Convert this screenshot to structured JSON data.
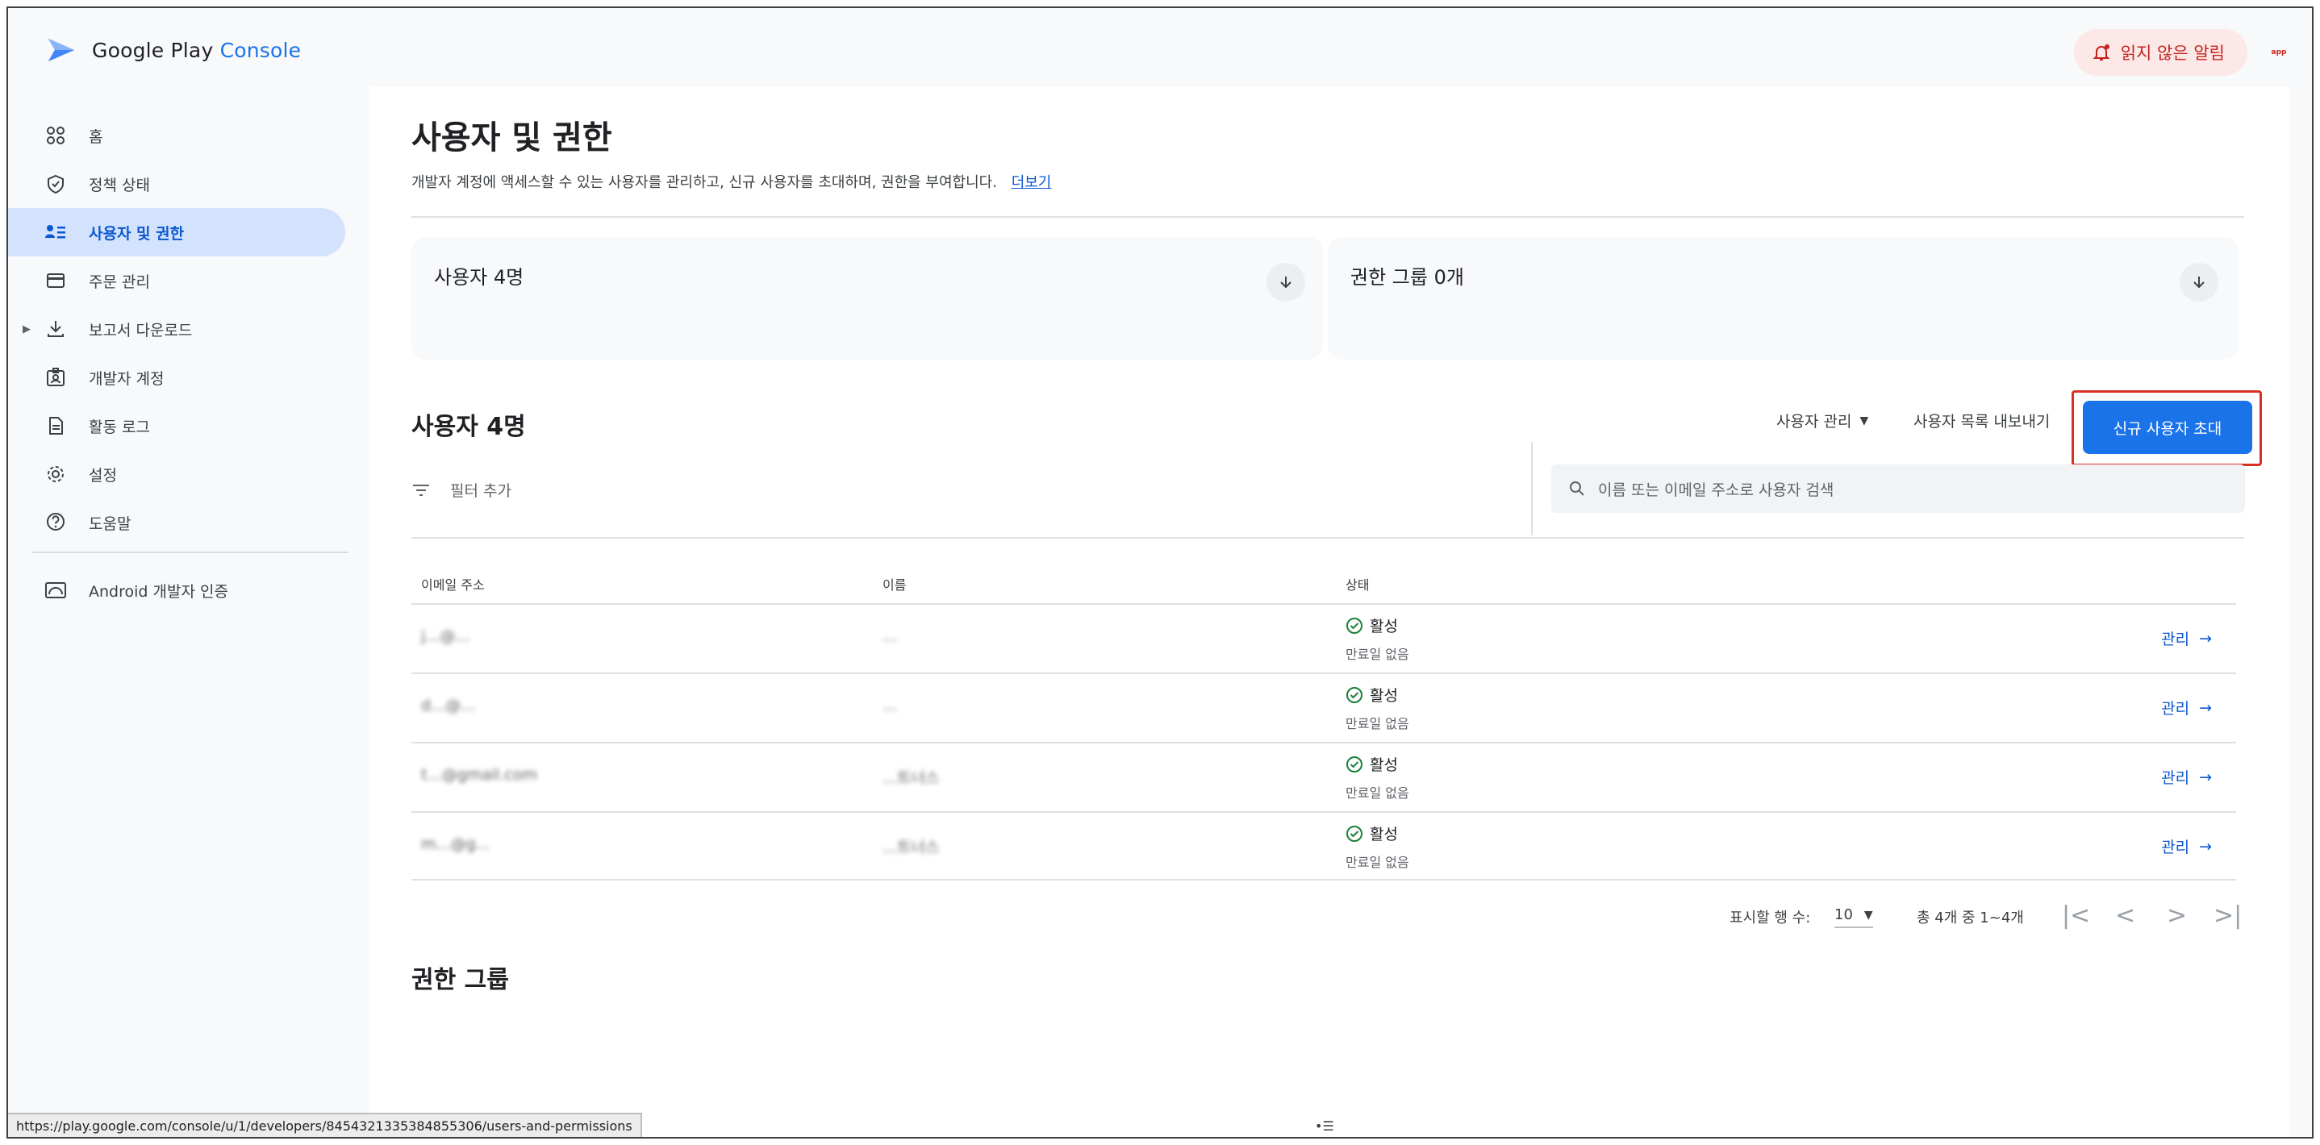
{
  "app": {
    "brand_google": "Google Play",
    "brand_console": "Console",
    "alert_label": "읽지 않은 알림",
    "avatar_text": "app"
  },
  "sidebar": {
    "items": [
      {
        "label": "홈",
        "icon": "grid-icon"
      },
      {
        "label": "정책 상태",
        "icon": "shield-icon"
      },
      {
        "label": "사용자 및 권한",
        "icon": "users-list-icon",
        "active": true
      },
      {
        "label": "주문 관리",
        "icon": "card-icon"
      },
      {
        "label": "보고서 다운로드",
        "icon": "download-icon"
      },
      {
        "label": "개발자 계정",
        "icon": "id-card-icon"
      },
      {
        "label": "활동 로그",
        "icon": "document-icon"
      },
      {
        "label": "설정",
        "icon": "gear-icon"
      },
      {
        "label": "도움말",
        "icon": "help-icon"
      }
    ],
    "android_item": "Android 개발자 인증"
  },
  "page": {
    "title": "사용자 및 권한",
    "description": "개발자 계정에 액세스할 수 있는 사용자를 관리하고, 신규 사용자를 초대하며, 권한을 부여합니다.",
    "learn_more": "더보기"
  },
  "summary": {
    "users_card": "사용자 4명",
    "groups_card": "권한 그룹 0개"
  },
  "users_section": {
    "title": "사용자 4명",
    "manage_users": "사용자 관리",
    "export_list": "사용자 목록 내보내기",
    "invite_button": "신규 사용자 초대",
    "filter_label": "필터 추가",
    "search_placeholder": "이름 또는 이메일 주소로 사용자 검색",
    "columns": {
      "email": "이메일 주소",
      "name": "이름",
      "status": "상태"
    },
    "rows": [
      {
        "email": "j...@...",
        "name": "...",
        "status": "활성",
        "expiry": "만료일 없음",
        "action": "관리"
      },
      {
        "email": "d...@...",
        "name": "...",
        "status": "활성",
        "expiry": "만료일 없음",
        "action": "관리"
      },
      {
        "email": "t...@gmail.com",
        "name": "...트너스",
        "status": "활성",
        "expiry": "만료일 없음",
        "action": "관리"
      },
      {
        "email": "m...@g...",
        "name": "...트너스",
        "status": "활성",
        "expiry": "만료일 없음",
        "action": "관리"
      }
    ]
  },
  "pagination": {
    "rows_label": "표시할 행 수:",
    "rows_value": "10",
    "range": "총 4개 중 1~4개"
  },
  "groups_section": {
    "title": "권한 그룹"
  },
  "statusbar": {
    "url": "https://play.google.com/console/u/1/developers/8454321335384855306/users-and-permissions"
  },
  "colors": {
    "accent": "#1a73e8",
    "active_nav_bg": "#d3e3fd",
    "highlight_border": "#d93025",
    "status_ok": "#188038"
  }
}
